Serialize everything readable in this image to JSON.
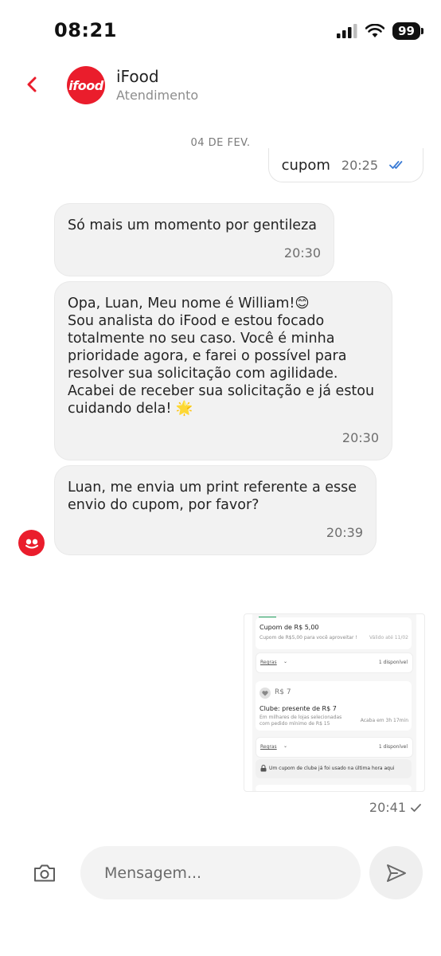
{
  "status_bar": {
    "time": "08:21",
    "battery": "99"
  },
  "header": {
    "logo_text": "ifood",
    "title": "iFood",
    "subtitle": "Atendimento"
  },
  "date_separator": "04 DE FEV.",
  "messages": [
    {
      "from": "user",
      "text": "cupom",
      "time": "20:25"
    },
    {
      "from": "agent",
      "text": "Só mais um momento por gentileza",
      "time": "20:30"
    },
    {
      "from": "agent",
      "text": "Opa, Luan, Meu nome é William!😊\nSou analista do iFood e estou focado totalmente no seu caso. Você é minha prioridade agora, e farei o possível para resolver sua solicitação com agilidade. Acabei de receber sua solicitação e já estou cuidando dela! 🌟",
      "time": "20:30"
    },
    {
      "from": "agent",
      "text": "Luan, me envia um print referente a esse envio do cupom, por favor?",
      "time": "20:39"
    }
  ],
  "image_message": {
    "time": "20:41",
    "coupon1": {
      "title": "Cupom de R$ 5,00",
      "desc": "Cupom de R$5,00 para você aproveitar !",
      "validity": "Válido até 11/02",
      "rules": "Regras",
      "availability": "1 disponível"
    },
    "coupon2": {
      "value": "R$ 7",
      "title": "Clube: presente de R$ 7",
      "desc_line1": "Em milhares de lojas selecionadas",
      "desc_line2": "com pedido mínimo de R$ 15",
      "expires": "Acaba em 3h 17min",
      "rules": "Regras",
      "availability": "1 disponível",
      "notice": "Um cupom de clube já foi usado na última hora aqui"
    }
  },
  "composer": {
    "placeholder": "Mensagem..."
  },
  "colors": {
    "brand": "#ea1d2c",
    "read_receipt": "#3a7bd5"
  }
}
